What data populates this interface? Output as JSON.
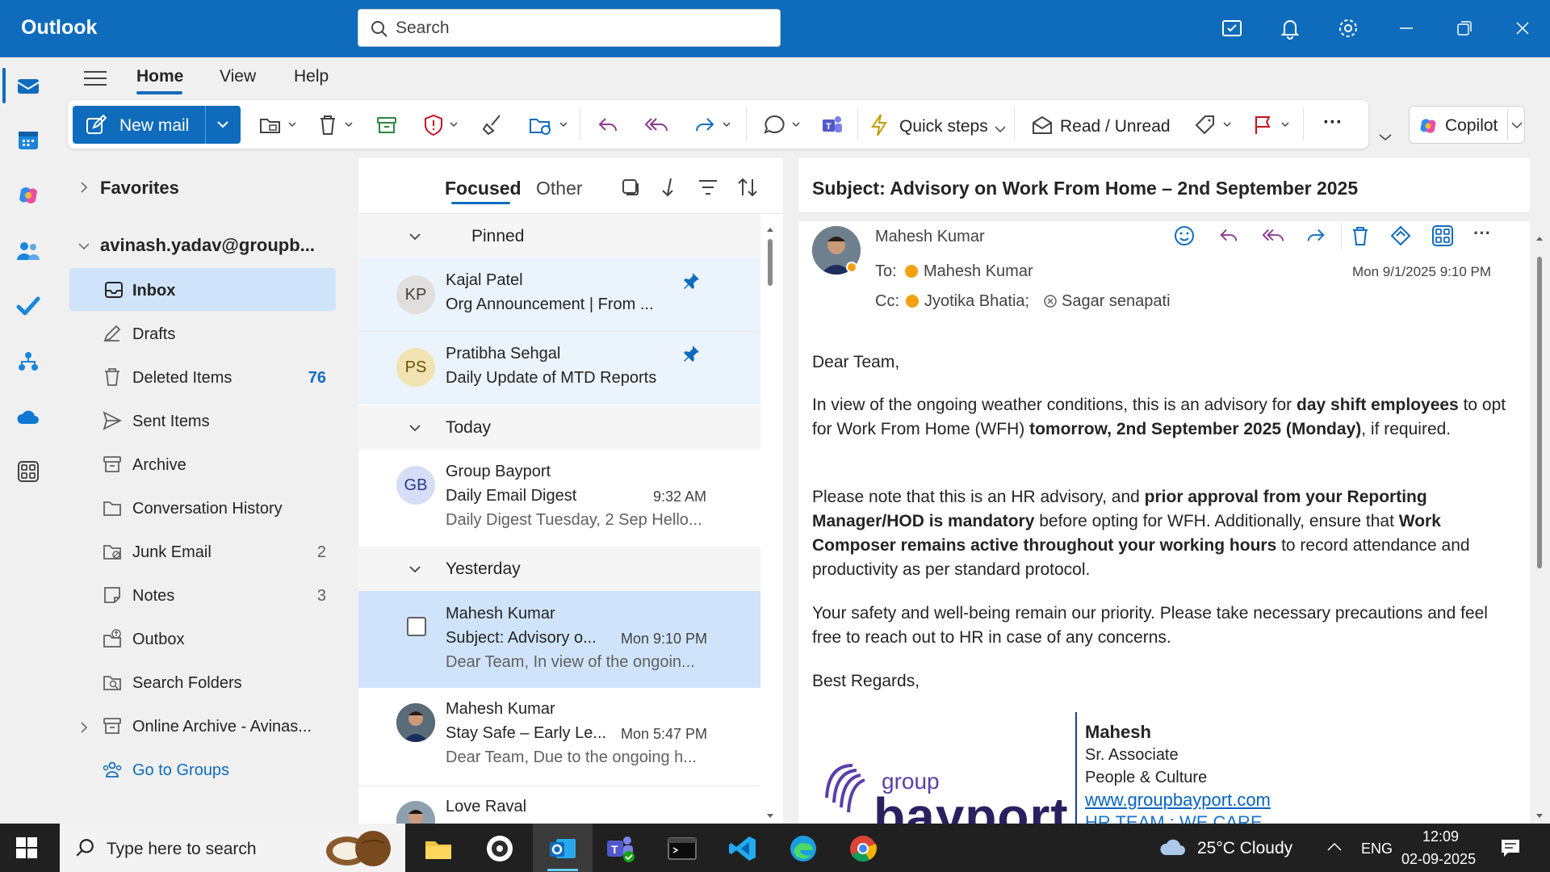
{
  "app": {
    "title": "Outlook"
  },
  "search": {
    "placeholder": "Search"
  },
  "menu_tabs": [
    "Home",
    "View",
    "Help"
  ],
  "ribbon": {
    "new_mail": "New mail",
    "quick_steps": "Quick steps",
    "read_unread": "Read / Unread",
    "copilot": "Copilot",
    "more": "···"
  },
  "folders": {
    "favorites": "Favorites",
    "account": "avinash.yadav@groupb...",
    "items": [
      {
        "label": "Inbox",
        "count": ""
      },
      {
        "label": "Drafts",
        "count": ""
      },
      {
        "label": "Deleted Items",
        "count": "76"
      },
      {
        "label": "Sent Items",
        "count": ""
      },
      {
        "label": "Archive",
        "count": ""
      },
      {
        "label": "Conversation History",
        "count": ""
      },
      {
        "label": "Junk Email",
        "count": "2"
      },
      {
        "label": "Notes",
        "count": "3"
      },
      {
        "label": "Outbox",
        "count": ""
      },
      {
        "label": "Search Folders",
        "count": ""
      },
      {
        "label": "Online Archive - Avinas...",
        "count": ""
      }
    ],
    "go_to_groups": "Go to Groups"
  },
  "list": {
    "tabs": [
      "Focused",
      "Other"
    ],
    "sections": {
      "pinned": "Pinned",
      "today": "Today",
      "yesterday": "Yesterday"
    },
    "messages": [
      {
        "initials": "KP",
        "sender": "Kajal Patel",
        "subject": "Org Announcement | From ...",
        "time": "",
        "preview": ""
      },
      {
        "initials": "PS",
        "sender": "Pratibha Sehgal",
        "subject": "Daily Update of MTD Reports",
        "time": "",
        "preview": ""
      },
      {
        "initials": "GB",
        "sender": "Group Bayport",
        "subject": "Daily Email Digest",
        "time": "9:32 AM",
        "preview": "Daily Digest Tuesday, 2 Sep Hello..."
      },
      {
        "initials": "",
        "sender": "Mahesh Kumar",
        "subject": "Subject: Advisory o...",
        "time": "Mon 9:10 PM",
        "preview": "Dear Team, In view of the ongoin..."
      },
      {
        "initials": "",
        "sender": "Mahesh Kumar",
        "subject": "Stay Safe – Early Le...",
        "time": "Mon 5:47 PM",
        "preview": "Dear Team, Due to the ongoing h..."
      },
      {
        "initials": "",
        "sender": "Love Raval",
        "subject": "",
        "time": "",
        "preview": ""
      }
    ]
  },
  "reading": {
    "subject": "Subject: Advisory on Work From Home – 2nd September 2025",
    "from": "Mahesh Kumar",
    "to_label": "To:",
    "to": "Mahesh Kumar",
    "cc_label": "Cc:",
    "cc1": "Jyotika Bhatia;",
    "cc2": "Sagar senapati",
    "date": "Mon 9/1/2025 9:10 PM",
    "greeting": "Dear Team,",
    "p1": [
      "In view of the ongoing weather conditions, this is an advisory for ",
      "day shift employees",
      " to opt for Work From Home (WFH) ",
      "tomorrow, 2nd September 2025 (Monday)",
      ", if required."
    ],
    "p2": [
      "Please note that this is an HR advisory, and ",
      "prior approval from your Reporting Manager/HOD is mandatory",
      " before opting for WFH. Additionally, ensure that ",
      "Work Composer remains active throughout your working hours",
      " to record attendance and productivity as per standard protocol."
    ],
    "p3": "Your safety and well-being remain our priority. Please take necessary precautions and feel free to reach out to HR in case of any concerns.",
    "regards": "Best Regards,",
    "sig_name": "Mahesh",
    "sig_title": "Sr. Associate",
    "sig_dept": "People & Culture",
    "sig_url": "www.groupbayport.com",
    "sig_tag": "HR TEAM : WE CARE",
    "logo_top": "group",
    "logo_bottom": "bayport"
  },
  "taskbar": {
    "search_placeholder": "Type here to search",
    "weather": "25°C  Cloudy",
    "lang": "ENG",
    "time": "12:09",
    "date": "02-09-2025"
  },
  "colors": {
    "accent": "#0f6cbd",
    "selected": "#cfe4fa",
    "pinned_bg": "#ebf3fc"
  }
}
